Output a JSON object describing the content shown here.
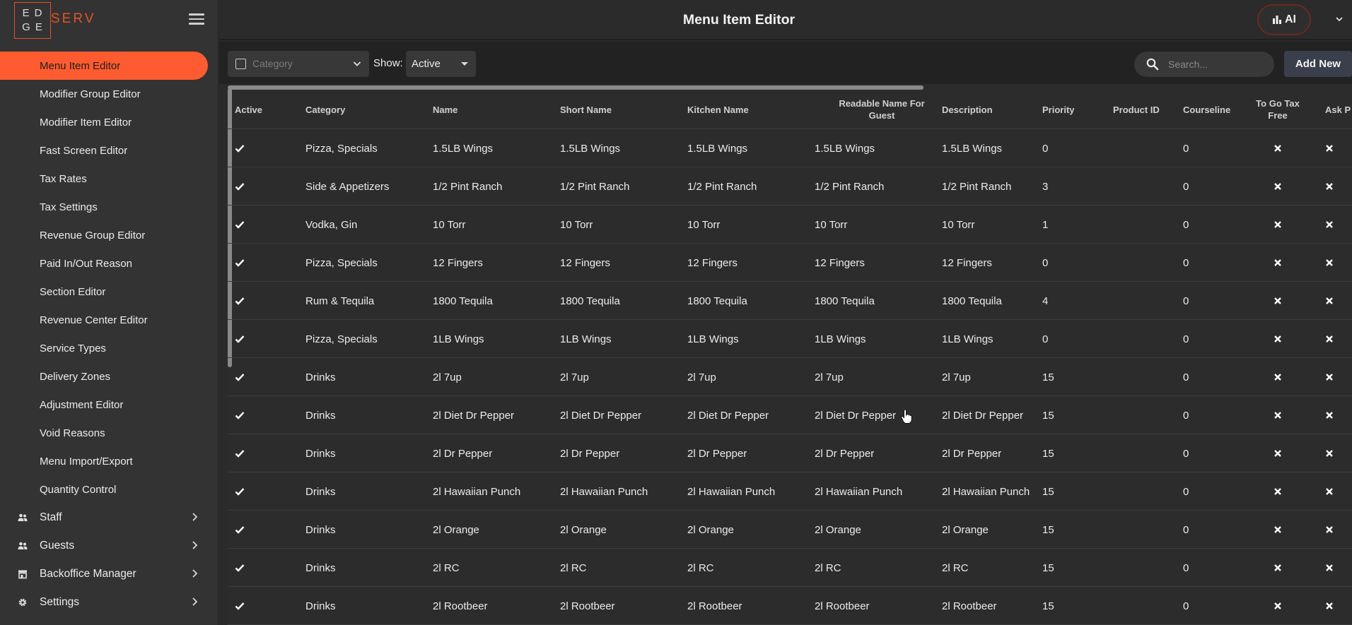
{
  "brand": {
    "logo_box": "EDGE",
    "logo_suffix": "SERV"
  },
  "header": {
    "title": "Menu Item Editor",
    "ai_label": "AI"
  },
  "sidebar": {
    "items": [
      {
        "label": "Menu Item Editor",
        "active": true
      },
      {
        "label": "Modifier Group Editor"
      },
      {
        "label": "Modifier Item Editor"
      },
      {
        "label": "Fast Screen Editor"
      },
      {
        "label": "Tax Rates"
      },
      {
        "label": "Tax Settings"
      },
      {
        "label": "Revenue Group Editor"
      },
      {
        "label": "Paid In/Out Reason"
      },
      {
        "label": "Section Editor"
      },
      {
        "label": "Revenue Center Editor"
      },
      {
        "label": "Service Types"
      },
      {
        "label": "Delivery Zones"
      },
      {
        "label": "Adjustment Editor"
      },
      {
        "label": "Void Reasons"
      },
      {
        "label": "Menu Import/Export"
      },
      {
        "label": "Quantity Control"
      }
    ],
    "groups": [
      {
        "label": "Staff",
        "icon": "people-icon"
      },
      {
        "label": "Guests",
        "icon": "people-icon"
      },
      {
        "label": "Backoffice Manager",
        "icon": "store-icon"
      },
      {
        "label": "Settings",
        "icon": "gear-icon"
      }
    ]
  },
  "toolbar": {
    "category_placeholder": "Category",
    "show_label": "Show:",
    "show_value": "Active",
    "search_placeholder": "Search...",
    "add_label": "Add New"
  },
  "table": {
    "headers": {
      "active": "Active",
      "category": "Category",
      "name": "Name",
      "short_name": "Short Name",
      "kitchen_name": "Kitchen Name",
      "readable_1": "Readable Name For",
      "readable_2": "Guest",
      "description": "Description",
      "priority": "Priority",
      "product_id": "Product ID",
      "courseline": "Courseline",
      "togo_1": "To Go Tax",
      "togo_2": "Free",
      "ask": "Ask P"
    },
    "rows": [
      {
        "category": "Pizza, Specials",
        "name": "1.5LB Wings",
        "short": "1.5LB Wings",
        "kitchen": "1.5LB Wings",
        "readable": "1.5LB Wings",
        "description": "1.5LB Wings",
        "priority": "0",
        "product_id": "",
        "courseline": "0"
      },
      {
        "category": "Side & Appetizers",
        "name": "1/2 Pint Ranch",
        "short": "1/2 Pint Ranch",
        "kitchen": "1/2 Pint Ranch",
        "readable": "1/2 Pint Ranch",
        "description": "1/2 Pint Ranch",
        "priority": "3",
        "product_id": "",
        "courseline": "0"
      },
      {
        "category": "Vodka, Gin",
        "name": "10 Torr",
        "short": "10 Torr",
        "kitchen": "10 Torr",
        "readable": "10 Torr",
        "description": "10 Torr",
        "priority": "1",
        "product_id": "",
        "courseline": "0"
      },
      {
        "category": "Pizza, Specials",
        "name": "12 Fingers",
        "short": "12 Fingers",
        "kitchen": "12 Fingers",
        "readable": "12 Fingers",
        "description": "12 Fingers",
        "priority": "0",
        "product_id": "",
        "courseline": "0"
      },
      {
        "category": "Rum & Tequila",
        "name": "1800 Tequila",
        "short": "1800 Tequila",
        "kitchen": "1800 Tequila",
        "readable": "1800 Tequila",
        "description": "1800 Tequila",
        "priority": "4",
        "product_id": "",
        "courseline": "0"
      },
      {
        "category": "Pizza, Specials",
        "name": "1LB Wings",
        "short": "1LB Wings",
        "kitchen": "1LB Wings",
        "readable": "1LB Wings",
        "description": "1LB Wings",
        "priority": "0",
        "product_id": "",
        "courseline": "0"
      },
      {
        "category": "Drinks",
        "name": "2l 7up",
        "short": "2l 7up",
        "kitchen": "2l 7up",
        "readable": "2l 7up",
        "description": "2l 7up",
        "priority": "15",
        "product_id": "",
        "courseline": "0"
      },
      {
        "category": "Drinks",
        "name": "2l Diet Dr Pepper",
        "short": "2l Diet Dr Pepper",
        "kitchen": "2l Diet Dr Pepper",
        "readable": "2l Diet Dr Pepper",
        "description": "2l Diet Dr Pepper",
        "priority": "15",
        "product_id": "",
        "courseline": "0"
      },
      {
        "category": "Drinks",
        "name": "2l Dr Pepper",
        "short": "2l Dr Pepper",
        "kitchen": "2l Dr Pepper",
        "readable": "2l Dr Pepper",
        "description": "2l Dr Pepper",
        "priority": "15",
        "product_id": "",
        "courseline": "0"
      },
      {
        "category": "Drinks",
        "name": "2l Hawaiian Punch",
        "short": "2l Hawaiian Punch",
        "kitchen": "2l Hawaiian Punch",
        "readable": "2l Hawaiian Punch",
        "description": "2l Hawaiian Punch",
        "priority": "15",
        "product_id": "",
        "courseline": "0"
      },
      {
        "category": "Drinks",
        "name": "2l Orange",
        "short": "2l Orange",
        "kitchen": "2l Orange",
        "readable": "2l Orange",
        "description": "2l Orange",
        "priority": "15",
        "product_id": "",
        "courseline": "0"
      },
      {
        "category": "Drinks",
        "name": "2l RC",
        "short": "2l RC",
        "kitchen": "2l RC",
        "readable": "2l RC",
        "description": "2l RC",
        "priority": "15",
        "product_id": "",
        "courseline": "0"
      },
      {
        "category": "Drinks",
        "name": "2l Rootbeer",
        "short": "2l Rootbeer",
        "kitchen": "2l Rootbeer",
        "readable": "2l Rootbeer",
        "description": "2l Rootbeer",
        "priority": "15",
        "product_id": "",
        "courseline": "0"
      }
    ]
  },
  "colors": {
    "accent": "#ff5b30",
    "sidebar_bg": "#333333",
    "table_bg": "#2c2c2c"
  }
}
